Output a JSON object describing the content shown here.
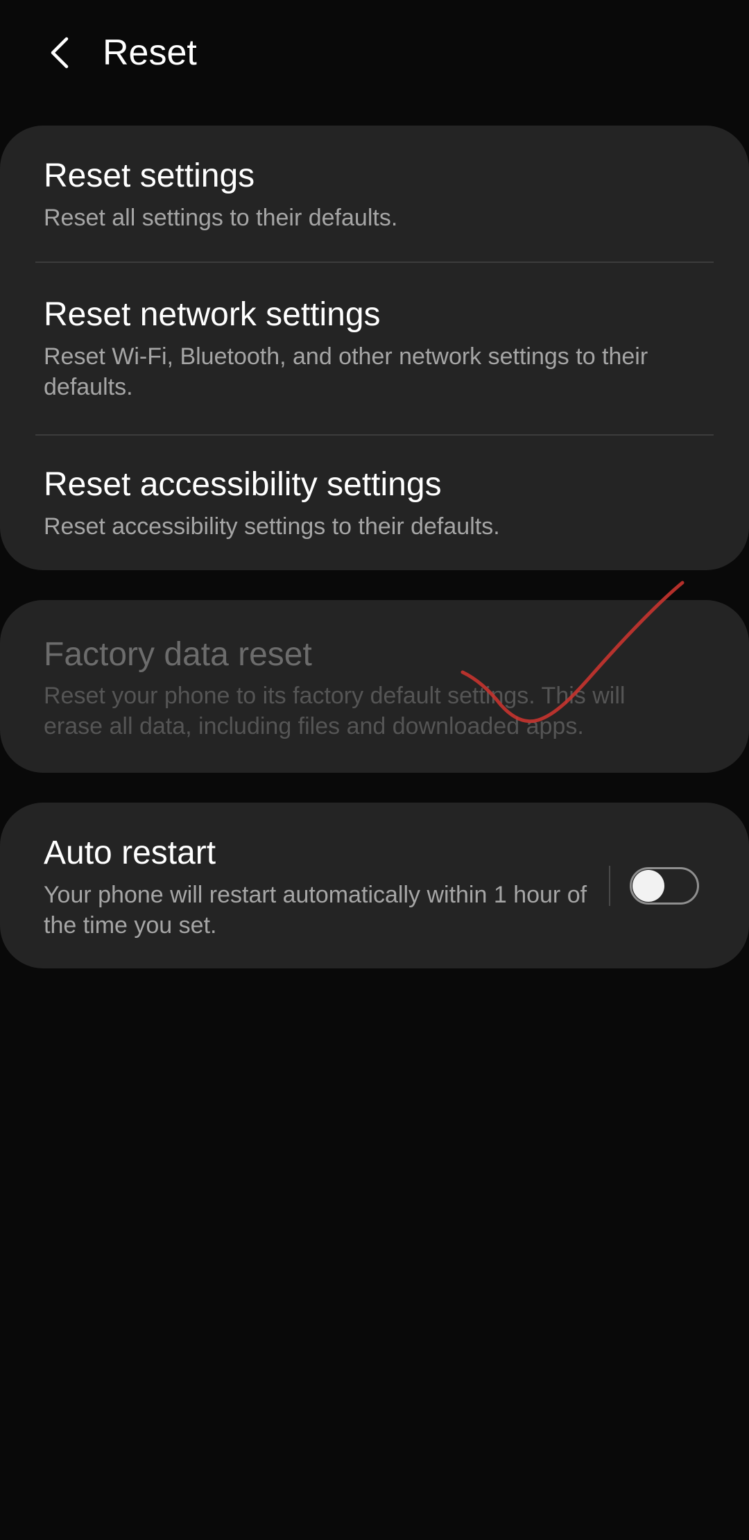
{
  "header": {
    "title": "Reset",
    "back_icon": "chevron-left-icon"
  },
  "reset_group": {
    "items": [
      {
        "title": "Reset settings",
        "subtitle": "Reset all settings to their defaults."
      },
      {
        "title": "Reset network settings",
        "subtitle": "Reset Wi-Fi, Bluetooth, and other network settings to their defaults."
      },
      {
        "title": "Reset accessibility settings",
        "subtitle": "Reset accessibility settings to their defaults."
      }
    ]
  },
  "factory_reset": {
    "title": "Factory data reset",
    "subtitle": "Reset your phone to its factory default settings. This will erase all data, including files and downloaded apps.",
    "state": "disabled"
  },
  "auto_restart": {
    "title": "Auto restart",
    "subtitle": "Your phone will restart automatically within 1 hour of the time you set.",
    "toggle_on": false
  },
  "annotation": {
    "type": "checkmark-scribble",
    "color": "#c8342f"
  },
  "colors": {
    "background": "#090909",
    "card": "#242424",
    "text_primary": "#ffffff",
    "text_secondary": "#a6a6a6"
  }
}
